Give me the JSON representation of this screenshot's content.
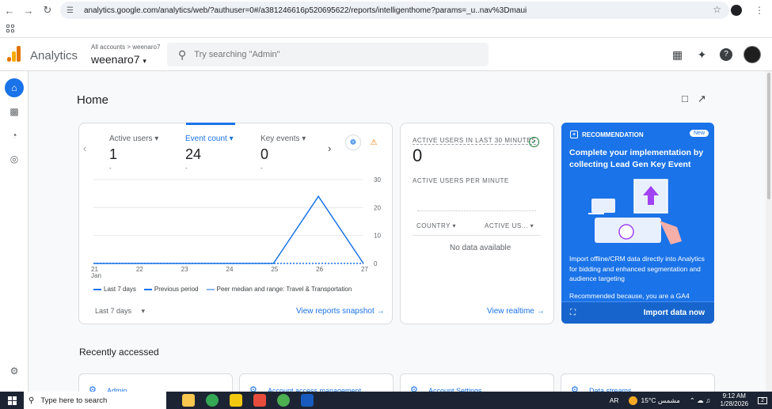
{
  "browser": {
    "url": "analytics.google.com/analytics/web/?authuser=0#/a381246616p520695622/reports/intelligenthome?params=_u..nav%3Dmaui"
  },
  "header": {
    "app_name": "Analytics",
    "breadcrumb": "All accounts  >  weenaro7",
    "account": "weenaro7",
    "search_placeholder": "Try searching \"Admin\""
  },
  "page": {
    "title": "Home"
  },
  "overview": {
    "metrics": [
      {
        "label": "Active users",
        "value": "1",
        "sub": "-"
      },
      {
        "label": "Event count",
        "value": "24",
        "sub": "-"
      },
      {
        "label": "Key events",
        "value": "0",
        "sub": "-"
      }
    ],
    "legend": {
      "current": "Last 7 days",
      "previous": "Previous period",
      "peer": "Peer median and range: Travel & Transportation"
    },
    "period": "Last 7 days",
    "link": "View reports snapshot"
  },
  "chart_data": {
    "type": "line",
    "x": [
      "21",
      "22",
      "23",
      "24",
      "25",
      "26",
      "27"
    ],
    "x_sublabel": "Jan",
    "series": [
      {
        "name": "Last 7 days",
        "values": [
          0,
          0,
          0,
          0,
          0,
          24,
          0
        ]
      },
      {
        "name": "Previous period",
        "values": [
          0,
          0,
          0,
          0,
          0,
          0,
          0
        ]
      }
    ],
    "yticks": [
      0,
      10,
      20,
      30
    ],
    "ylim": [
      0,
      30
    ],
    "grid": true,
    "legend": "bottom",
    "colors": {
      "current": "#1a73e8",
      "previous": "#1a73e8",
      "peer": "#8ab4f8"
    }
  },
  "realtime": {
    "title": "ACTIVE USERS IN LAST 30 MINUTES",
    "value": "0",
    "per_minute": "ACTIVE USERS PER MINUTE",
    "col_country": "COUNTRY",
    "col_active": "ACTIVE US...",
    "empty": "No data available",
    "link": "View realtime"
  },
  "recommendation": {
    "label": "RECOMMENDATION",
    "badge": "New",
    "title": "Complete your implementation by collecting Lead Gen Key Event",
    "body": "Import offline/CRM data directly into Analytics for bidding and enhanced segmentation and audience targeting",
    "reason": "Recommended because, you are a GA4",
    "cta": "Import data now"
  },
  "recent": {
    "title": "Recently accessed",
    "items": [
      "Admin",
      "Account access management",
      "Account Settings",
      "Data streams"
    ]
  },
  "taskbar": {
    "search": "Type here to search",
    "lang": "AR",
    "weather": "15°C  مشمس",
    "time": "9:12 AM",
    "date": "1/28/2026",
    "notif": "2"
  },
  "colors": {
    "accent": "#1a73e8",
    "warning": "#e37400",
    "success": "#188038"
  }
}
